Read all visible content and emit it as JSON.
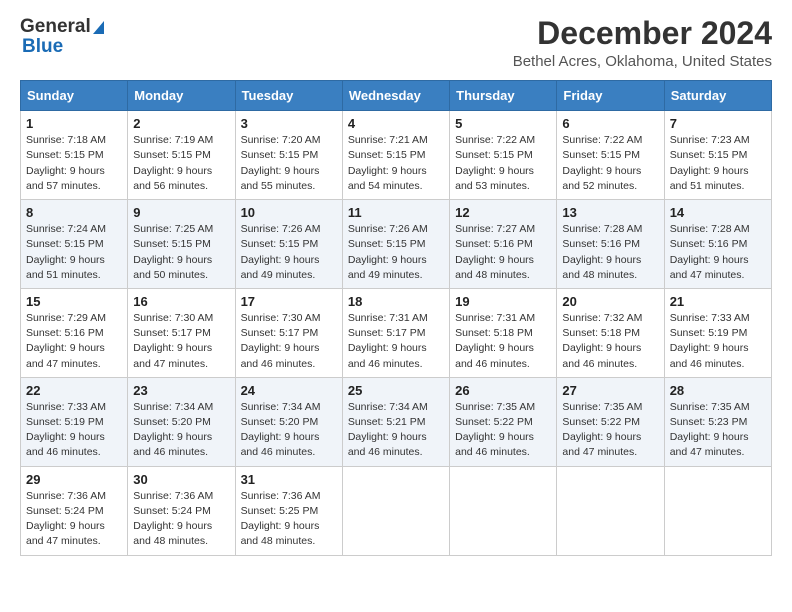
{
  "logo": {
    "line1": "General",
    "line2": "Blue"
  },
  "title": "December 2024",
  "subtitle": "Bethel Acres, Oklahoma, United States",
  "header": {
    "days": [
      "Sunday",
      "Monday",
      "Tuesday",
      "Wednesday",
      "Thursday",
      "Friday",
      "Saturday"
    ]
  },
  "weeks": [
    [
      {
        "day": "1",
        "sunrise": "7:18 AM",
        "sunset": "5:15 PM",
        "daylight": "9 hours and 57 minutes."
      },
      {
        "day": "2",
        "sunrise": "7:19 AM",
        "sunset": "5:15 PM",
        "daylight": "9 hours and 56 minutes."
      },
      {
        "day": "3",
        "sunrise": "7:20 AM",
        "sunset": "5:15 PM",
        "daylight": "9 hours and 55 minutes."
      },
      {
        "day": "4",
        "sunrise": "7:21 AM",
        "sunset": "5:15 PM",
        "daylight": "9 hours and 54 minutes."
      },
      {
        "day": "5",
        "sunrise": "7:22 AM",
        "sunset": "5:15 PM",
        "daylight": "9 hours and 53 minutes."
      },
      {
        "day": "6",
        "sunrise": "7:22 AM",
        "sunset": "5:15 PM",
        "daylight": "9 hours and 52 minutes."
      },
      {
        "day": "7",
        "sunrise": "7:23 AM",
        "sunset": "5:15 PM",
        "daylight": "9 hours and 51 minutes."
      }
    ],
    [
      {
        "day": "8",
        "sunrise": "7:24 AM",
        "sunset": "5:15 PM",
        "daylight": "9 hours and 51 minutes."
      },
      {
        "day": "9",
        "sunrise": "7:25 AM",
        "sunset": "5:15 PM",
        "daylight": "9 hours and 50 minutes."
      },
      {
        "day": "10",
        "sunrise": "7:26 AM",
        "sunset": "5:15 PM",
        "daylight": "9 hours and 49 minutes."
      },
      {
        "day": "11",
        "sunrise": "7:26 AM",
        "sunset": "5:15 PM",
        "daylight": "9 hours and 49 minutes."
      },
      {
        "day": "12",
        "sunrise": "7:27 AM",
        "sunset": "5:16 PM",
        "daylight": "9 hours and 48 minutes."
      },
      {
        "day": "13",
        "sunrise": "7:28 AM",
        "sunset": "5:16 PM",
        "daylight": "9 hours and 48 minutes."
      },
      {
        "day": "14",
        "sunrise": "7:28 AM",
        "sunset": "5:16 PM",
        "daylight": "9 hours and 47 minutes."
      }
    ],
    [
      {
        "day": "15",
        "sunrise": "7:29 AM",
        "sunset": "5:16 PM",
        "daylight": "9 hours and 47 minutes."
      },
      {
        "day": "16",
        "sunrise": "7:30 AM",
        "sunset": "5:17 PM",
        "daylight": "9 hours and 47 minutes."
      },
      {
        "day": "17",
        "sunrise": "7:30 AM",
        "sunset": "5:17 PM",
        "daylight": "9 hours and 46 minutes."
      },
      {
        "day": "18",
        "sunrise": "7:31 AM",
        "sunset": "5:17 PM",
        "daylight": "9 hours and 46 minutes."
      },
      {
        "day": "19",
        "sunrise": "7:31 AM",
        "sunset": "5:18 PM",
        "daylight": "9 hours and 46 minutes."
      },
      {
        "day": "20",
        "sunrise": "7:32 AM",
        "sunset": "5:18 PM",
        "daylight": "9 hours and 46 minutes."
      },
      {
        "day": "21",
        "sunrise": "7:33 AM",
        "sunset": "5:19 PM",
        "daylight": "9 hours and 46 minutes."
      }
    ],
    [
      {
        "day": "22",
        "sunrise": "7:33 AM",
        "sunset": "5:19 PM",
        "daylight": "9 hours and 46 minutes."
      },
      {
        "day": "23",
        "sunrise": "7:34 AM",
        "sunset": "5:20 PM",
        "daylight": "9 hours and 46 minutes."
      },
      {
        "day": "24",
        "sunrise": "7:34 AM",
        "sunset": "5:20 PM",
        "daylight": "9 hours and 46 minutes."
      },
      {
        "day": "25",
        "sunrise": "7:34 AM",
        "sunset": "5:21 PM",
        "daylight": "9 hours and 46 minutes."
      },
      {
        "day": "26",
        "sunrise": "7:35 AM",
        "sunset": "5:22 PM",
        "daylight": "9 hours and 46 minutes."
      },
      {
        "day": "27",
        "sunrise": "7:35 AM",
        "sunset": "5:22 PM",
        "daylight": "9 hours and 47 minutes."
      },
      {
        "day": "28",
        "sunrise": "7:35 AM",
        "sunset": "5:23 PM",
        "daylight": "9 hours and 47 minutes."
      }
    ],
    [
      {
        "day": "29",
        "sunrise": "7:36 AM",
        "sunset": "5:24 PM",
        "daylight": "9 hours and 47 minutes."
      },
      {
        "day": "30",
        "sunrise": "7:36 AM",
        "sunset": "5:24 PM",
        "daylight": "9 hours and 48 minutes."
      },
      {
        "day": "31",
        "sunrise": "7:36 AM",
        "sunset": "5:25 PM",
        "daylight": "9 hours and 48 minutes."
      },
      null,
      null,
      null,
      null
    ]
  ]
}
